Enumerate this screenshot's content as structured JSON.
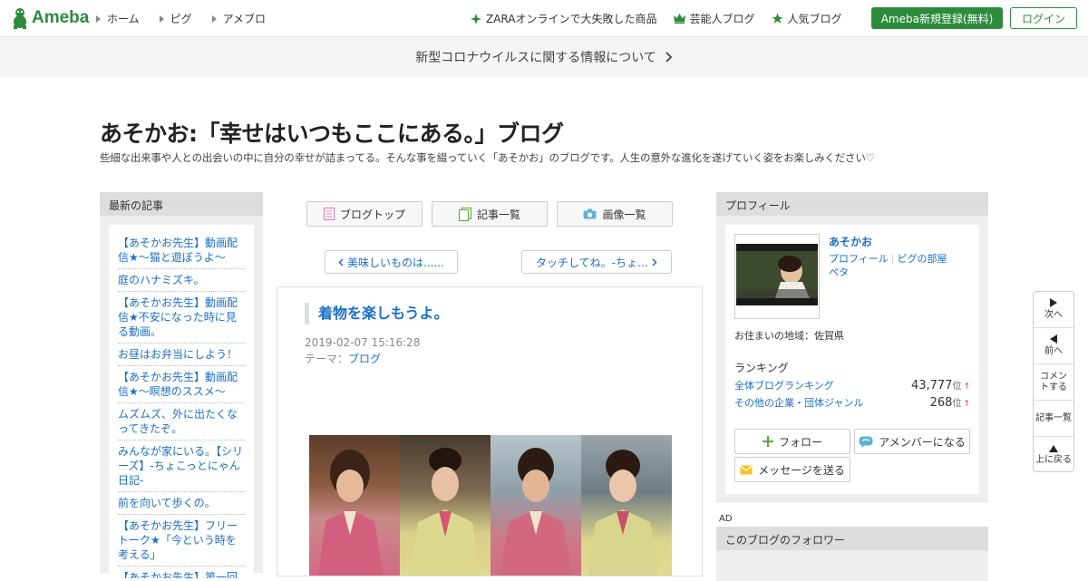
{
  "header": {
    "logo": "Ameba",
    "nav": [
      "ホーム",
      "ピグ",
      "アメブロ"
    ],
    "right_nav": [
      {
        "label": "ZARAオンラインで大失敗した商品",
        "icon": "sparkle-icon"
      },
      {
        "label": "芸能人ブログ",
        "icon": "crown-icon"
      },
      {
        "label": "人気ブログ",
        "icon": "star-icon"
      }
    ],
    "register_label": "Ameba新規登録(無料)",
    "login_label": "ログイン",
    "accent": "#2d8c3c"
  },
  "banner": {
    "text": "新型コロナウイルスに関する情報について"
  },
  "blog": {
    "title": "あそかお:「幸せはいつもここにある。」ブログ",
    "description": "些細な出来事や人との出会いの中に自分の幸せが詰まってる。そんな事を綴っていく「あそかお」のブログです。人生の意外な進化を遂げていく姿をお楽しみください♡"
  },
  "recent": {
    "heading": "最新の記事",
    "items": [
      "【あそかお先生】動画配信★〜猫と遊ぼうよ〜",
      "庭のハナミズキ。",
      "【あそかお先生】動画配信★不安になった時に見る動画。",
      "お昼はお弁当にしよう！",
      "【あそかお先生】動画配信★〜瞑想のススメ〜",
      "ムズムズ、外に出たくなってきたぞ。",
      "みんなが家にいる。【シリーズ】-ちょこっとにゃん日記-",
      "前を向いて歩くの。",
      "【あそかお先生】フリートーク★「今という時を考える」",
      "【あそかお先生】第一回目★動画配信中〜あそか"
    ]
  },
  "tabs": [
    {
      "label": "ブログトップ",
      "icon": "document-icon"
    },
    {
      "label": "記事一覧",
      "icon": "pages-icon"
    },
    {
      "label": "画像一覧",
      "icon": "camera-icon"
    }
  ],
  "pager": {
    "prev": "美味しいものは......",
    "next": "タッチしてね。-ちょ…"
  },
  "article": {
    "title": "着物を楽しもうよ。",
    "date": "2019-02-07 15:16:28",
    "theme_label": "テーマ：",
    "theme_value": "ブログ"
  },
  "profile": {
    "heading": "プロフィール",
    "name": "あそかお",
    "link1": "プロフィール",
    "sep": "|",
    "link2": "ピグの部屋",
    "link3": "ペタ",
    "residence": "お住まいの地域：佐賀県",
    "ranking_heading": "ランキング",
    "rankings": [
      {
        "label": "全体ブログランキング",
        "value": "43,777",
        "unit": "位",
        "trend": "↑"
      },
      {
        "label": "その他の企業・団体ジャンル",
        "value": "268",
        "unit": "位",
        "trend": "↑"
      }
    ],
    "follow_label": "フォロー",
    "amember_label": "アメンバーになる",
    "message_label": "メッセージを送る"
  },
  "ad_label": "AD",
  "followers_heading": "このブログのフォロワー",
  "sidenav": {
    "next": "次へ",
    "prev": "前へ",
    "comment": "コメントする",
    "list": "記事一覧",
    "top": "上に戻る"
  }
}
